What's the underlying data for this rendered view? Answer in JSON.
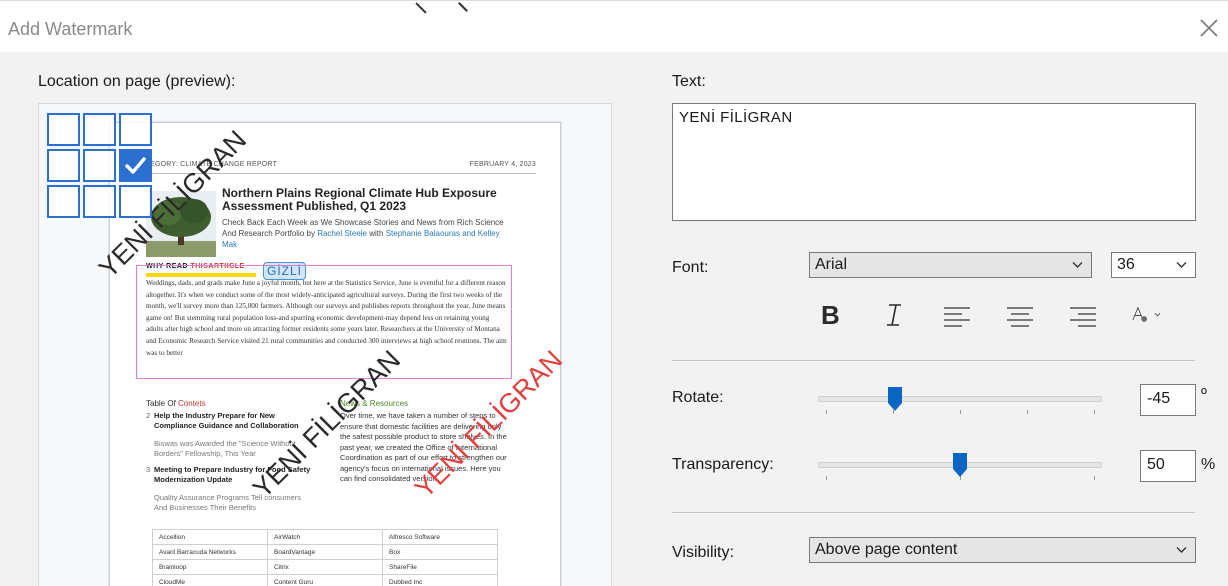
{
  "dialog": {
    "title": "Add Watermark",
    "close_icon": "close-icon"
  },
  "preview": {
    "label": "Location on page (preview):",
    "selected_cell": 5,
    "page": {
      "category": "CATEGORY: CLIMATE CHANGE REPORT",
      "date": "FEBRUARY 4, 2023",
      "title": "Northern Plains Regional Climate Hub Exposure Assessment Published, Q1 2023",
      "subtitle": "Check Back Each Week as We Showcase Stories and News from Rich Science And Research Portfolio",
      "by": "by",
      "author1": "Rachel Steele",
      "with": "with",
      "author2": "Stephanie Balaouras and Kelley Mak",
      "why_prefix": "WHY READ",
      "why_red": "THISARTIICLE",
      "body": "Weddings, dads, and grads make June a joyful month, but here at the Statistics Service, June is eventful for a different reason altogether. It's when we conduct some of the most widely-anticipated agricultural surveys. During the first two weeks of the month, we'll survey more than 125,000 farmers. Although our surveys and publishes reports throughout the year, June means game on! But stemming rural population loss-and spurring economic development-may depend less on retaining young adults after high school and more on attracting former residents some years later. Researchers at the University of Montana and Economic Research Service visited 21 rural communities and conducted 300 interviews at high school reunions. The aim was to better",
      "toc_prefix": "Table  Of",
      "toc_red": "Contets",
      "toc_items": [
        {
          "num": "2",
          "title": "Help the Industry Prepare for New Compliance Guidance and Collaboration",
          "desc": "Biswas was Awarded the \"Science Without Borders\" Fellowship, This Year"
        },
        {
          "num": "3",
          "title": "Meeting to Prepare Industry for Food Safety Modernization Update",
          "desc": "Quality Assurance Programs Tell consumers And Businesses Their Benefits"
        }
      ],
      "news_title": "News & Resources",
      "news_text": "Over time, we have taken a number of steps to ensure that domestic facilities are delivering only the safest possible product to store shelves. In the past year, we created the Office of International Coordination as part of our effort to strengthen our agency's focus on international issues. Here you can find consolidated version.",
      "vendors": [
        [
          "Accellion",
          "AirWatch",
          "Alfresco Software"
        ],
        [
          "Avaril Barracuda Networks",
          "BoardVantage",
          "Box"
        ],
        [
          "Brainloop",
          "Citrix",
          "ShareFile"
        ],
        [
          "CloudMe",
          "Content Guru",
          "Dubbed Inc"
        ]
      ]
    },
    "gizli": "GİZLİ",
    "watermark_grid": "YENİ FİLİGRAN",
    "watermark_center": "YENİ FİLİGRAN",
    "watermark_red": "YENİ FİLİGRAN",
    "colors": {
      "grid": "#2b6fd1",
      "selection": "#e07ad8",
      "watermark_red": "#e04040"
    }
  },
  "text": {
    "label": "Text:",
    "value": "YENİ FİLİGRAN"
  },
  "font": {
    "label": "Font:",
    "family": "Arial",
    "size": "36",
    "toolbar": [
      "bold-icon",
      "italic-icon",
      "align-left-icon",
      "align-center-icon",
      "align-right-icon",
      "font-color-icon"
    ]
  },
  "rotate": {
    "label": "Rotate:",
    "value": "-45",
    "unit": "º",
    "slider_fraction": 0.27
  },
  "transparency": {
    "label": "Transparency:",
    "value": "50",
    "unit": "%",
    "slider_fraction": 0.5
  },
  "visibility": {
    "label": "Visibility:",
    "value": "Above page content"
  }
}
